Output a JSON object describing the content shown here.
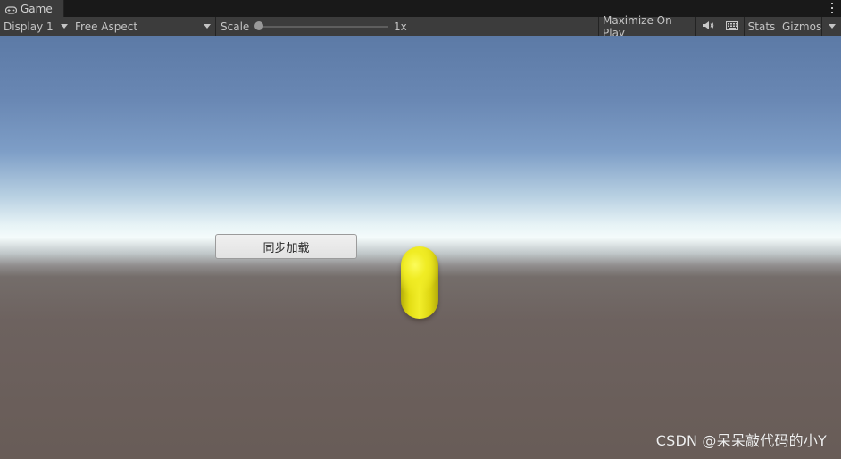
{
  "tab": {
    "title": "Game",
    "icon": "gamepad-icon"
  },
  "toolbar": {
    "display": "Display 1",
    "aspect": "Free Aspect",
    "scale_label": "Scale",
    "scale_value": "1x",
    "scale_slider_level": 0,
    "maximize": "Maximize On Play",
    "audio_icon": "speaker-icon",
    "grid_icon": "keyboard-icon",
    "stats": "Stats",
    "gizmos": "Gizmos",
    "menu_icon": "kebab-menu-icon"
  },
  "game": {
    "button_label": "同步加载",
    "capsule_color": "#e8e218",
    "sky_color": "#6987b3",
    "ground_color": "#6b5f5a"
  },
  "watermark": "CSDN @呆呆敲代码的小Y"
}
